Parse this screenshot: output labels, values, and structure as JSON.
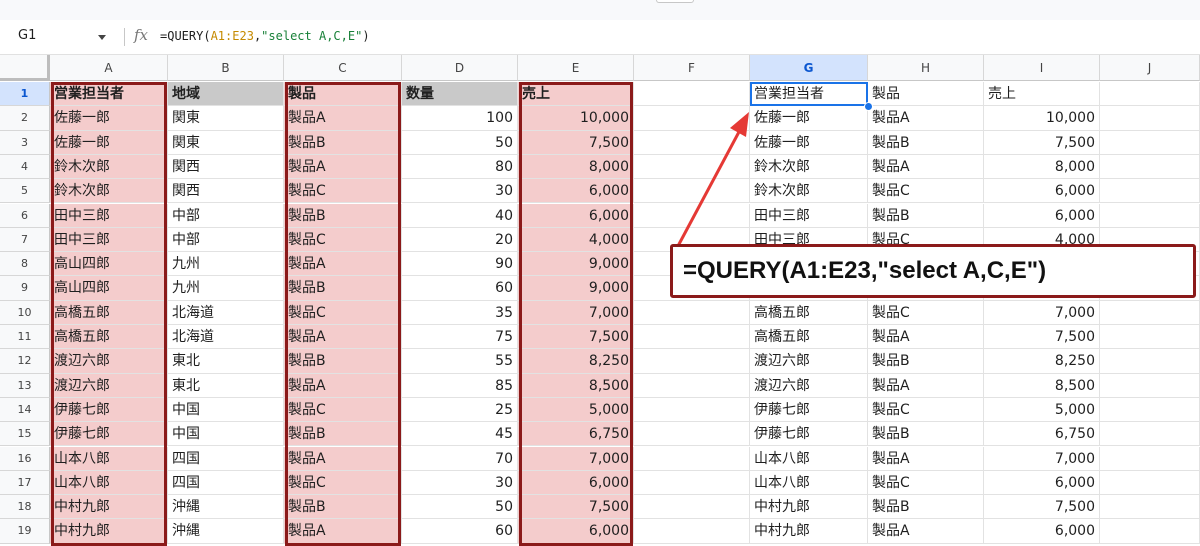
{
  "name_box": "G1",
  "formula": {
    "fx": "fx",
    "prefix": "=QUERY(",
    "range": "A1:E23",
    "sep": ",",
    "query": "\"select A,C,E\"",
    "suffix": ")"
  },
  "callout_text": "=QUERY(A1:E23,\"select A,C,E\")",
  "columns": [
    "A",
    "B",
    "C",
    "D",
    "E",
    "F",
    "G",
    "H",
    "I",
    "J"
  ],
  "rows": [
    "1",
    "2",
    "3",
    "4",
    "5",
    "6",
    "7",
    "8",
    "9",
    "10",
    "11",
    "12",
    "13",
    "14",
    "15",
    "16",
    "17",
    "18",
    "19"
  ],
  "source_headers": [
    "営業担当者",
    "地域",
    "製品",
    "数量",
    "売上"
  ],
  "source_rows": [
    [
      "佐藤一郎",
      "関東",
      "製品A",
      "100",
      "10,000"
    ],
    [
      "佐藤一郎",
      "関東",
      "製品B",
      "50",
      "7,500"
    ],
    [
      "鈴木次郎",
      "関西",
      "製品A",
      "80",
      "8,000"
    ],
    [
      "鈴木次郎",
      "関西",
      "製品C",
      "30",
      "6,000"
    ],
    [
      "田中三郎",
      "中部",
      "製品B",
      "40",
      "6,000"
    ],
    [
      "田中三郎",
      "中部",
      "製品C",
      "20",
      "4,000"
    ],
    [
      "高山四郎",
      "九州",
      "製品A",
      "90",
      "9,000"
    ],
    [
      "高山四郎",
      "九州",
      "製品B",
      "60",
      "9,000"
    ],
    [
      "高橋五郎",
      "北海道",
      "製品C",
      "35",
      "7,000"
    ],
    [
      "高橋五郎",
      "北海道",
      "製品A",
      "75",
      "7,500"
    ],
    [
      "渡辺六郎",
      "東北",
      "製品B",
      "55",
      "8,250"
    ],
    [
      "渡辺六郎",
      "東北",
      "製品A",
      "85",
      "8,500"
    ],
    [
      "伊藤七郎",
      "中国",
      "製品C",
      "25",
      "5,000"
    ],
    [
      "伊藤七郎",
      "中国",
      "製品B",
      "45",
      "6,750"
    ],
    [
      "山本八郎",
      "四国",
      "製品A",
      "70",
      "7,000"
    ],
    [
      "山本八郎",
      "四国",
      "製品C",
      "30",
      "6,000"
    ],
    [
      "中村九郎",
      "沖縄",
      "製品B",
      "50",
      "7,500"
    ],
    [
      "中村九郎",
      "沖縄",
      "製品A",
      "60",
      "6,000"
    ]
  ],
  "result_headers": [
    "営業担当者",
    "製品",
    "売上"
  ],
  "result_rows": [
    [
      "佐藤一郎",
      "製品A",
      "10,000"
    ],
    [
      "佐藤一郎",
      "製品B",
      "7,500"
    ],
    [
      "鈴木次郎",
      "製品A",
      "8,000"
    ],
    [
      "鈴木次郎",
      "製品C",
      "6,000"
    ],
    [
      "田中三郎",
      "製品B",
      "6,000"
    ],
    [
      "田中三郎",
      "製品C",
      "4,000"
    ],
    [
      "",
      "",
      ""
    ],
    [
      "",
      "",
      ""
    ],
    [
      "高橋五郎",
      "製品C",
      "7,000"
    ],
    [
      "高橋五郎",
      "製品A",
      "7,500"
    ],
    [
      "渡辺六郎",
      "製品B",
      "8,250"
    ],
    [
      "渡辺六郎",
      "製品A",
      "8,500"
    ],
    [
      "伊藤七郎",
      "製品C",
      "5,000"
    ],
    [
      "伊藤七郎",
      "製品B",
      "6,750"
    ],
    [
      "山本八郎",
      "製品A",
      "7,000"
    ],
    [
      "山本八郎",
      "製品C",
      "6,000"
    ],
    [
      "中村九郎",
      "製品B",
      "7,500"
    ],
    [
      "中村九郎",
      "製品A",
      "6,000"
    ]
  ],
  "colors": {
    "highlight": "#f4cccc",
    "box_border": "#8b1a1a",
    "arrow": "#e53935",
    "selection": "#1a73e8"
  }
}
